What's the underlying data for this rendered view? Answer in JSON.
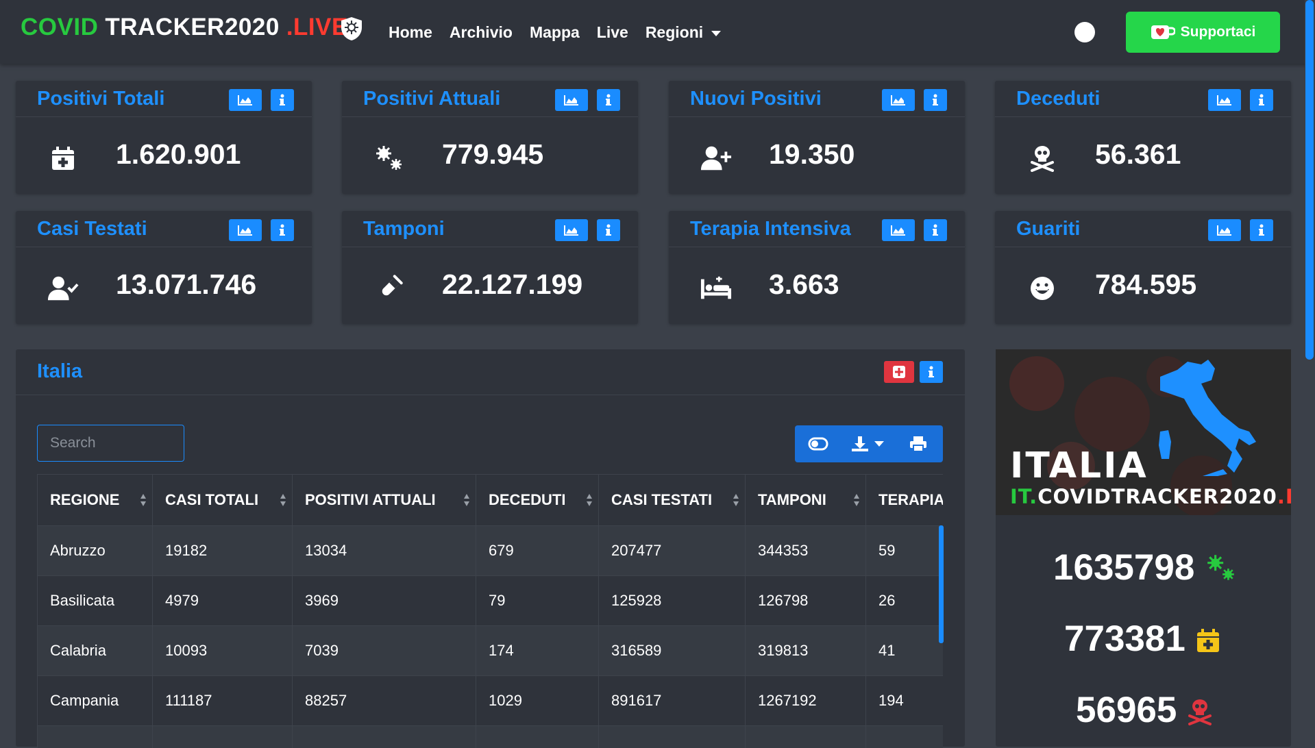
{
  "brand": {
    "part1": "COVID",
    "part2": "TRACKER2020",
    "part3": ".LIVE"
  },
  "nav": {
    "home": "Home",
    "archive": "Archivio",
    "map": "Mappa",
    "live": "Live",
    "regions": "Regioni"
  },
  "support": {
    "label": "Supportaci"
  },
  "cards": [
    {
      "title": "Positivi Totali",
      "value": "1.620.901",
      "icon": "calendar-plus-icon"
    },
    {
      "title": "Positivi Attuali",
      "value": "779.945",
      "icon": "viruses-icon"
    },
    {
      "title": "Nuovi Positivi",
      "value": "19.350",
      "icon": "user-plus-icon"
    },
    {
      "title": "Deceduti",
      "value": "56.361",
      "icon": "skull-crossbones-icon"
    },
    {
      "title": "Casi Testati",
      "value": "13.071.746",
      "icon": "user-check-icon"
    },
    {
      "title": "Tamponi",
      "value": "22.127.199",
      "icon": "test-tube-icon"
    },
    {
      "title": "Terapia Intensiva",
      "value": "3.663",
      "icon": "hospital-bed-icon"
    },
    {
      "title": "Guariti",
      "value": "784.595",
      "icon": "grin-icon"
    }
  ],
  "italia": {
    "title": "Italia",
    "search_placeholder": "Search",
    "columns": [
      "REGIONE",
      "CASI TOTALI",
      "POSITIVI ATTUALI",
      "DECEDUTI",
      "CASI TESTATI",
      "TAMPONI",
      "TERAPIA"
    ],
    "rows": [
      [
        "Abruzzo",
        "19182",
        "13034",
        "679",
        "207477",
        "344353",
        "59"
      ],
      [
        "Basilicata",
        "4979",
        "3969",
        "79",
        "125928",
        "126798",
        "26"
      ],
      [
        "Calabria",
        "10093",
        "7039",
        "174",
        "316589",
        "319813",
        "41"
      ],
      [
        "Campania",
        "111187",
        "88257",
        "1029",
        "891617",
        "1267192",
        "194"
      ]
    ]
  },
  "right_panel": {
    "map_title": "ITALIA",
    "map_site": {
      "a": "IT.",
      "b": "COVIDTRACKER2020",
      "c": ".LIVE"
    },
    "stats": [
      {
        "value": "1635798",
        "icon": "viruses-icon",
        "color": "#27c93f"
      },
      {
        "value": "773381",
        "icon": "calendar-plus-icon",
        "color": "#f5c518"
      },
      {
        "value": "56965",
        "icon": "skull-crossbones-icon",
        "color": "#e0353f"
      }
    ]
  },
  "colors": {
    "accent": "#1e90ff",
    "nav_bg": "#2f333b",
    "page_bg": "#3b4049",
    "support": "#25d64a",
    "danger": "#e0353f"
  }
}
